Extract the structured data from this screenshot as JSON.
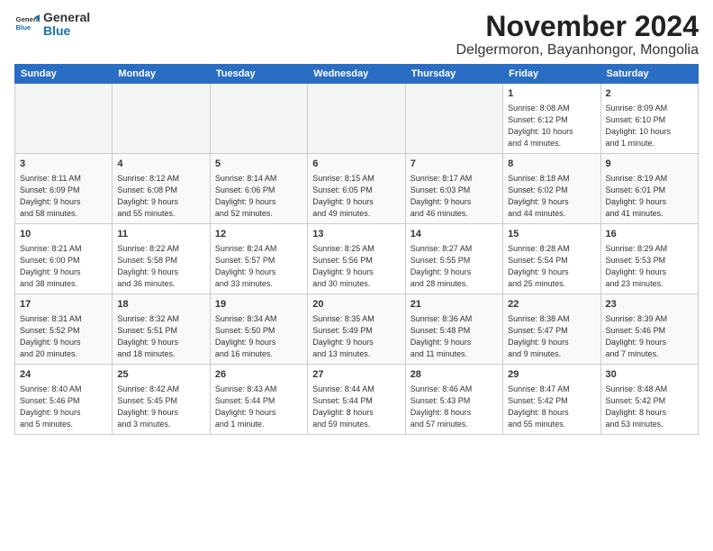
{
  "logo": {
    "line1": "General",
    "line2": "Blue"
  },
  "title": "November 2024",
  "location": "Delgermoron, Bayanhongor, Mongolia",
  "weekdays": [
    "Sunday",
    "Monday",
    "Tuesday",
    "Wednesday",
    "Thursday",
    "Friday",
    "Saturday"
  ],
  "weeks": [
    [
      {
        "day": "",
        "info": ""
      },
      {
        "day": "",
        "info": ""
      },
      {
        "day": "",
        "info": ""
      },
      {
        "day": "",
        "info": ""
      },
      {
        "day": "",
        "info": ""
      },
      {
        "day": "1",
        "info": "Sunrise: 8:08 AM\nSunset: 6:12 PM\nDaylight: 10 hours\nand 4 minutes."
      },
      {
        "day": "2",
        "info": "Sunrise: 8:09 AM\nSunset: 6:10 PM\nDaylight: 10 hours\nand 1 minute."
      }
    ],
    [
      {
        "day": "3",
        "info": "Sunrise: 8:11 AM\nSunset: 6:09 PM\nDaylight: 9 hours\nand 58 minutes."
      },
      {
        "day": "4",
        "info": "Sunrise: 8:12 AM\nSunset: 6:08 PM\nDaylight: 9 hours\nand 55 minutes."
      },
      {
        "day": "5",
        "info": "Sunrise: 8:14 AM\nSunset: 6:06 PM\nDaylight: 9 hours\nand 52 minutes."
      },
      {
        "day": "6",
        "info": "Sunrise: 8:15 AM\nSunset: 6:05 PM\nDaylight: 9 hours\nand 49 minutes."
      },
      {
        "day": "7",
        "info": "Sunrise: 8:17 AM\nSunset: 6:03 PM\nDaylight: 9 hours\nand 46 minutes."
      },
      {
        "day": "8",
        "info": "Sunrise: 8:18 AM\nSunset: 6:02 PM\nDaylight: 9 hours\nand 44 minutes."
      },
      {
        "day": "9",
        "info": "Sunrise: 8:19 AM\nSunset: 6:01 PM\nDaylight: 9 hours\nand 41 minutes."
      }
    ],
    [
      {
        "day": "10",
        "info": "Sunrise: 8:21 AM\nSunset: 6:00 PM\nDaylight: 9 hours\nand 38 minutes."
      },
      {
        "day": "11",
        "info": "Sunrise: 8:22 AM\nSunset: 5:58 PM\nDaylight: 9 hours\nand 36 minutes."
      },
      {
        "day": "12",
        "info": "Sunrise: 8:24 AM\nSunset: 5:57 PM\nDaylight: 9 hours\nand 33 minutes."
      },
      {
        "day": "13",
        "info": "Sunrise: 8:25 AM\nSunset: 5:56 PM\nDaylight: 9 hours\nand 30 minutes."
      },
      {
        "day": "14",
        "info": "Sunrise: 8:27 AM\nSunset: 5:55 PM\nDaylight: 9 hours\nand 28 minutes."
      },
      {
        "day": "15",
        "info": "Sunrise: 8:28 AM\nSunset: 5:54 PM\nDaylight: 9 hours\nand 25 minutes."
      },
      {
        "day": "16",
        "info": "Sunrise: 8:29 AM\nSunset: 5:53 PM\nDaylight: 9 hours\nand 23 minutes."
      }
    ],
    [
      {
        "day": "17",
        "info": "Sunrise: 8:31 AM\nSunset: 5:52 PM\nDaylight: 9 hours\nand 20 minutes."
      },
      {
        "day": "18",
        "info": "Sunrise: 8:32 AM\nSunset: 5:51 PM\nDaylight: 9 hours\nand 18 minutes."
      },
      {
        "day": "19",
        "info": "Sunrise: 8:34 AM\nSunset: 5:50 PM\nDaylight: 9 hours\nand 16 minutes."
      },
      {
        "day": "20",
        "info": "Sunrise: 8:35 AM\nSunset: 5:49 PM\nDaylight: 9 hours\nand 13 minutes."
      },
      {
        "day": "21",
        "info": "Sunrise: 8:36 AM\nSunset: 5:48 PM\nDaylight: 9 hours\nand 11 minutes."
      },
      {
        "day": "22",
        "info": "Sunrise: 8:38 AM\nSunset: 5:47 PM\nDaylight: 9 hours\nand 9 minutes."
      },
      {
        "day": "23",
        "info": "Sunrise: 8:39 AM\nSunset: 5:46 PM\nDaylight: 9 hours\nand 7 minutes."
      }
    ],
    [
      {
        "day": "24",
        "info": "Sunrise: 8:40 AM\nSunset: 5:46 PM\nDaylight: 9 hours\nand 5 minutes."
      },
      {
        "day": "25",
        "info": "Sunrise: 8:42 AM\nSunset: 5:45 PM\nDaylight: 9 hours\nand 3 minutes."
      },
      {
        "day": "26",
        "info": "Sunrise: 8:43 AM\nSunset: 5:44 PM\nDaylight: 9 hours\nand 1 minute."
      },
      {
        "day": "27",
        "info": "Sunrise: 8:44 AM\nSunset: 5:44 PM\nDaylight: 8 hours\nand 59 minutes."
      },
      {
        "day": "28",
        "info": "Sunrise: 8:46 AM\nSunset: 5:43 PM\nDaylight: 8 hours\nand 57 minutes."
      },
      {
        "day": "29",
        "info": "Sunrise: 8:47 AM\nSunset: 5:42 PM\nDaylight: 8 hours\nand 55 minutes."
      },
      {
        "day": "30",
        "info": "Sunrise: 8:48 AM\nSunset: 5:42 PM\nDaylight: 8 hours\nand 53 minutes."
      }
    ]
  ]
}
